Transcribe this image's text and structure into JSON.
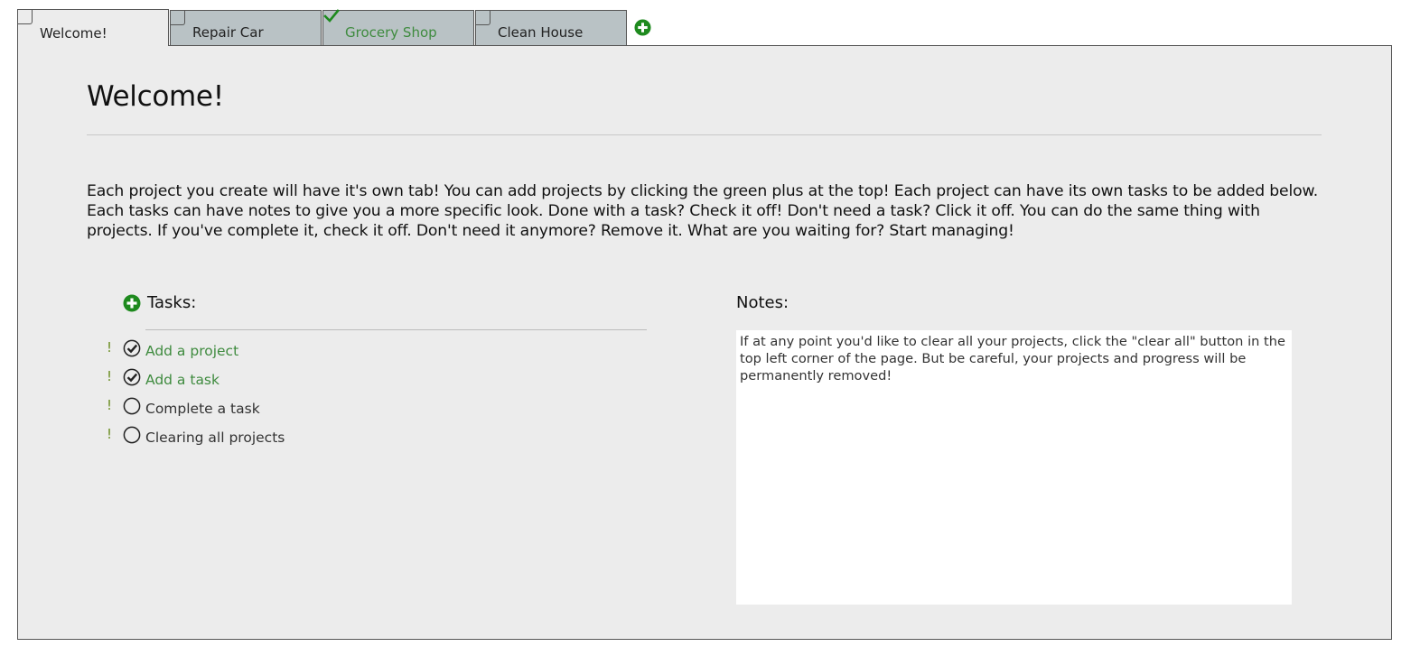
{
  "colors": {
    "accent_green": "#1e8a1e",
    "done_text": "#3f8b3f",
    "tab_inactive": "#b9c2c5",
    "panel_bg": "#ececec",
    "priority": "#6b8e23"
  },
  "tabs": [
    {
      "label": "Welcome!",
      "checked": false,
      "active": true
    },
    {
      "label": "Repair Car",
      "checked": false,
      "active": false
    },
    {
      "label": "Grocery Shop",
      "checked": true,
      "active": false
    },
    {
      "label": "Clean House",
      "checked": false,
      "active": false
    }
  ],
  "add_project_icon": "plus-circle-icon",
  "project": {
    "title": "Welcome!",
    "description": "Each project you create will have it's own tab! You can add projects by clicking the green plus at the top! Each project can have its own tasks to be added below. Each tasks can have notes to give you a more specific look. Done with a task? Check it off! Don't need a task? Click it off. You can do the same thing with projects. If you've complete it, check it off. Don't need it anymore? Remove it. What are you waiting for? Start managing!"
  },
  "tasks": {
    "header": "Tasks:",
    "add_icon": "plus-circle-icon",
    "items": [
      {
        "priority": "!",
        "label": "Add a project",
        "done": true
      },
      {
        "priority": "!",
        "label": "Add a task",
        "done": true
      },
      {
        "priority": "!",
        "label": "Complete a task",
        "done": false
      },
      {
        "priority": "!",
        "label": "Clearing all projects",
        "done": false
      }
    ]
  },
  "notes": {
    "header": "Notes:",
    "value": "If at any point you'd like to clear all your projects, click the \"clear all\" button in the top left corner of the page. But be careful, your projects and progress will be permanently removed!"
  }
}
